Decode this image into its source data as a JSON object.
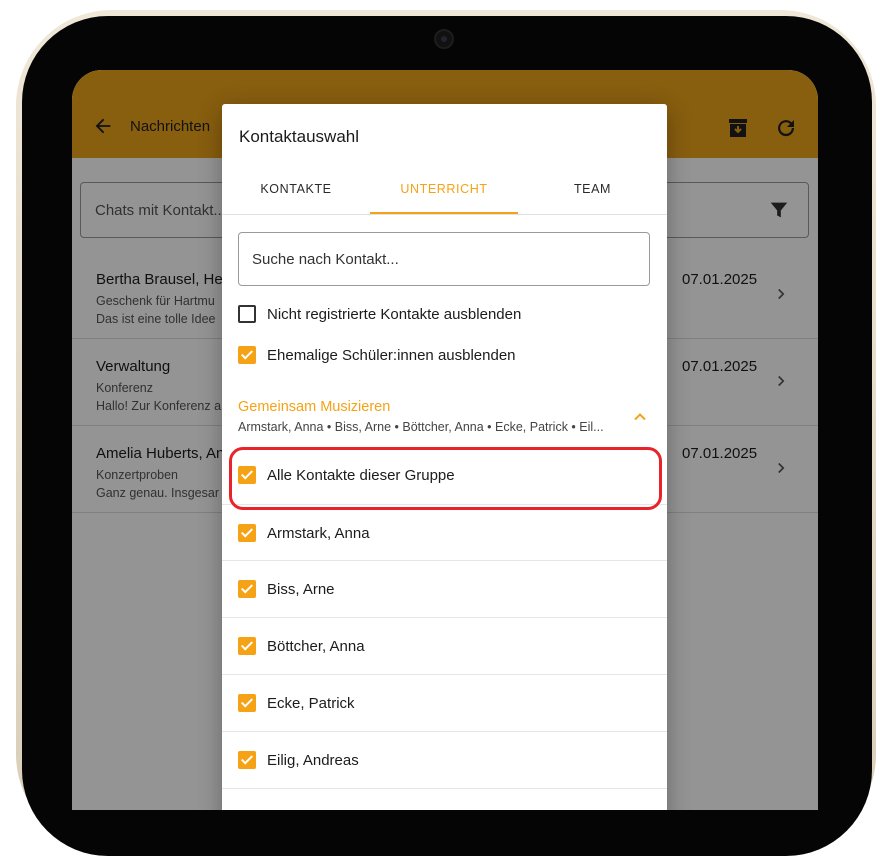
{
  "app": {
    "back_label": "Nachrichten",
    "filter_placeholder": "Chats mit Kontakt..."
  },
  "chats": [
    {
      "name": "Bertha Brausel, Hei",
      "subject": "Geschenk für Hartmu",
      "preview": "Das ist eine tolle Idee",
      "date": "07.01.2025"
    },
    {
      "name": "Verwaltung",
      "subject": "Konferenz",
      "preview": "Hallo! Zur Konferenz a",
      "date": "07.01.2025"
    },
    {
      "name": "Amelia Huberts, An",
      "subject": "Konzertproben",
      "preview": "Ganz genau. Insgesar",
      "date": "07.01.2025"
    }
  ],
  "dialog": {
    "title": "Kontaktauswahl",
    "tabs": [
      {
        "label": "KONTAKTE",
        "active": false
      },
      {
        "label": "UNTERRICHT",
        "active": true
      },
      {
        "label": "TEAM",
        "active": false
      }
    ],
    "search_placeholder": "Suche nach Kontakt...",
    "options": [
      {
        "label": "Nicht registrierte Kontakte ausblenden",
        "checked": false
      },
      {
        "label": "Ehemalige Schüler:innen ausblenden",
        "checked": true
      }
    ],
    "group": {
      "title": "Gemeinsam Musizieren",
      "members_summary": "Armstark, Anna • Biss, Arne • Böttcher, Anna • Ecke, Patrick • Eil...",
      "all_label": "Alle Kontakte dieser Gruppe",
      "all_checked": true,
      "expanded": true
    },
    "members": [
      {
        "label": "Armstark, Anna",
        "checked": true
      },
      {
        "label": "Biss, Arne",
        "checked": true
      },
      {
        "label": "Böttcher, Anna",
        "checked": true
      },
      {
        "label": "Ecke, Patrick",
        "checked": true
      },
      {
        "label": "Eilig, Andreas",
        "checked": true
      }
    ]
  },
  "colors": {
    "accent": "#f5a216",
    "app_bar": "#eaa21a",
    "highlight": "#e8232a"
  }
}
